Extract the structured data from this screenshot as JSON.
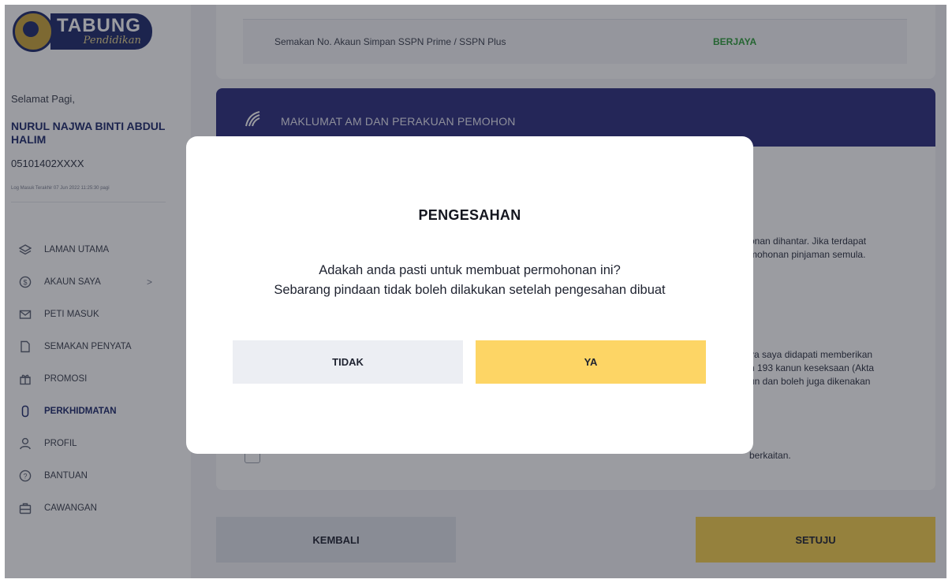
{
  "logo": {
    "title": "TABUNG",
    "subtitle": "Pendidikan"
  },
  "user": {
    "greeting": "Selamat Pagi,",
    "name": "NURUL NAJWA BINTI ABDUL HALIM",
    "id": "05101402XXXX",
    "last_login": "Log Masuk Terakhir 07 Jun 2022 11:25:30 pagi"
  },
  "sidebar": {
    "items": [
      {
        "label": "LAMAN UTAMA",
        "icon": "layers-icon"
      },
      {
        "label": "AKAUN SAYA",
        "icon": "dollar-circle-icon",
        "chevron": ">"
      },
      {
        "label": "PETI MASUK",
        "icon": "mail-icon"
      },
      {
        "label": "SEMAKAN PENYATA",
        "icon": "document-icon"
      },
      {
        "label": "PROMOSI",
        "icon": "gift-icon"
      },
      {
        "label": "PERKHIDMATAN",
        "icon": "phone-icon",
        "active": true
      },
      {
        "label": "PROFIL",
        "icon": "user-icon"
      },
      {
        "label": "BANTUAN",
        "icon": "help-circle-icon"
      },
      {
        "label": "CAWANGAN",
        "icon": "briefcase-icon"
      }
    ]
  },
  "verification": {
    "label": "Semakan No. Akaun Simpan SSPN Prime / SSPN Plus",
    "status": "BERJAYA",
    "status_color": "#2e9d3a"
  },
  "section": {
    "title": "MAKLUMAT AM DAN PERAKUAN PEMOHON",
    "text1_line1": "onan dihantar. Jika terdapat",
    "text1_line2": "mohonan pinjaman semula.",
    "text2_line1": "ya saya didapati memberikan",
    "text2_line2": "n 193 kanun keseksaan (Akta",
    "text2_line3": "un dan boleh juga dikenakan",
    "text3": "berkaitan."
  },
  "buttons": {
    "back": "KEMBALI",
    "agree": "SETUJU"
  },
  "modal": {
    "title": "PENGESAHAN",
    "message_line1": "Adakah anda pasti untuk membuat permohonan ini?",
    "message_line2": "Sebarang pindaan tidak boleh dilakukan setelah pengesahan dibuat",
    "no_label": "TIDAK",
    "yes_label": "YA"
  },
  "colors": {
    "brand_navy": "#2c2d7e",
    "accent_yellow": "#fdd565",
    "success_green": "#2e9d3a",
    "overlay": "rgba(28,30,40,0.44)"
  }
}
